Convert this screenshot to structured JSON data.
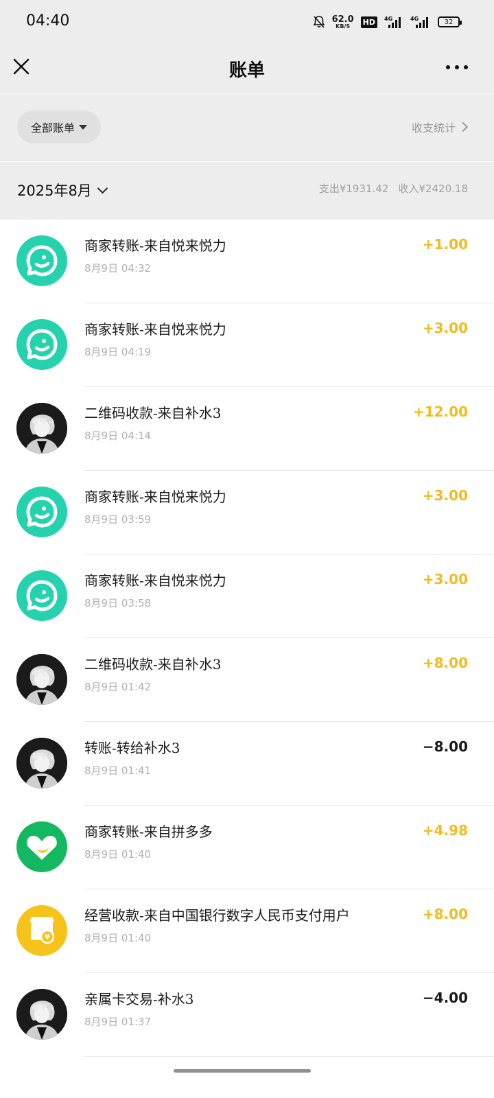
{
  "status_bar": {
    "time": "04:40",
    "net_speed_value": "62.0",
    "net_speed_unit": "KB/S",
    "hd_badge": "HD",
    "sig1_label": "4G",
    "sig2_label": "4G",
    "battery": "32"
  },
  "nav": {
    "title": "账单",
    "close_icon": "close-icon",
    "more_icon": "more-icon"
  },
  "filter": {
    "pill_label": "全部账单",
    "stats_label": "收支统计"
  },
  "month": {
    "label": "2025年8月",
    "expense": "支出¥1931.42",
    "income": "收入¥2420.18"
  },
  "colors": {
    "income_amount": "#f3bb1c",
    "expense_amount": "#1a1a1a",
    "smile_avatar": "#24d2ad",
    "pdd_avatar": "#13b860",
    "shop_avatar": "#f6c31b"
  },
  "transactions": [
    {
      "title": "商家转账-来自悦来悦力",
      "time": "8月9日 04:32",
      "amount": "+1.00",
      "direction": "in",
      "avatar": "smile-logo-icon"
    },
    {
      "title": "商家转账-来自悦来悦力",
      "time": "8月9日 04:19",
      "amount": "+3.00",
      "direction": "in",
      "avatar": "smile-logo-icon"
    },
    {
      "title": "二维码收款-来自补水3",
      "time": "8月9日 04:14",
      "amount": "+12.00",
      "direction": "in",
      "avatar": "user-photo"
    },
    {
      "title": "商家转账-来自悦来悦力",
      "time": "8月9日 03:59",
      "amount": "+3.00",
      "direction": "in",
      "avatar": "smile-logo-icon"
    },
    {
      "title": "商家转账-来自悦来悦力",
      "time": "8月9日 03:58",
      "amount": "+3.00",
      "direction": "in",
      "avatar": "smile-logo-icon"
    },
    {
      "title": "二维码收款-来自补水3",
      "time": "8月9日 01:42",
      "amount": "+8.00",
      "direction": "in",
      "avatar": "user-photo"
    },
    {
      "title": "转账-转给补水3",
      "time": "8月9日 01:41",
      "amount": "−8.00",
      "direction": "out",
      "avatar": "user-photo"
    },
    {
      "title": "商家转账-来自拼多多",
      "time": "8月9日 01:40",
      "amount": "+4.98",
      "direction": "in",
      "avatar": "pinduoduo-logo-icon"
    },
    {
      "title": "经营收款-来自中国银行数字人民币支付用户",
      "time": "8月9日 01:40",
      "amount": "+8.00",
      "direction": "in",
      "avatar": "shop-yuan-icon"
    },
    {
      "title": "亲属卡交易-补水3",
      "time": "8月9日 01:37",
      "amount": "−4.00",
      "direction": "out",
      "avatar": "user-photo"
    }
  ]
}
